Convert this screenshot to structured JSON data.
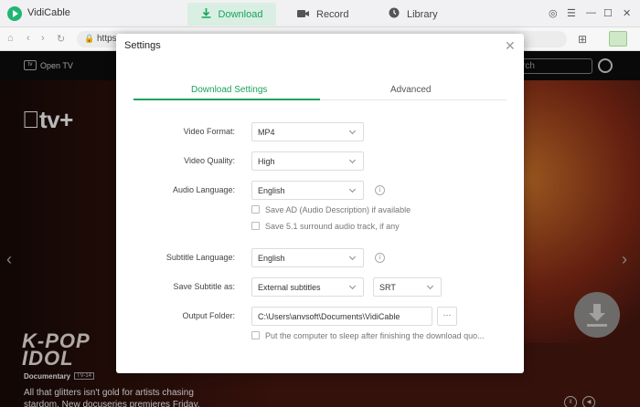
{
  "app": {
    "name": "VidiCable"
  },
  "tabs": {
    "download": "Download",
    "record": "Record",
    "library": "Library"
  },
  "address": {
    "url": "https"
  },
  "site": {
    "open_tv": "Open TV",
    "brand": "tv+",
    "search_placeholder": "rch",
    "show_title_line1": "K-POP",
    "show_title_line2": "IDOL",
    "category": "Documentary",
    "rating": "TV-14",
    "promo": "All that glitters isn't gold for artists chasing stardom. New docuseries premieres Friday."
  },
  "dialog": {
    "title": "Settings",
    "tab_download": "Download Settings",
    "tab_advanced": "Advanced",
    "video_format_label": "Video Format:",
    "video_format_value": "MP4",
    "video_quality_label": "Video Quality:",
    "video_quality_value": "High",
    "audio_language_label": "Audio Language:",
    "audio_language_value": "English",
    "save_ad_label": "Save AD (Audio Description) if available",
    "save_51_label": "Save 5.1 surround audio track, if any",
    "subtitle_language_label": "Subtitle Language:",
    "subtitle_language_value": "English",
    "save_subtitle_label": "Save Subtitle as:",
    "save_subtitle_value": "External subtitles",
    "subtitle_format_value": "SRT",
    "output_folder_label": "Output Folder:",
    "output_folder_value": "C:\\Users\\anvsoft\\Documents\\VidiCable",
    "browse_label": "···",
    "sleep_label": "Put the computer to sleep after finishing the download quo..."
  },
  "colors": {
    "accent": "#1aa35c",
    "tab_active_bg": "#d9efe3"
  }
}
